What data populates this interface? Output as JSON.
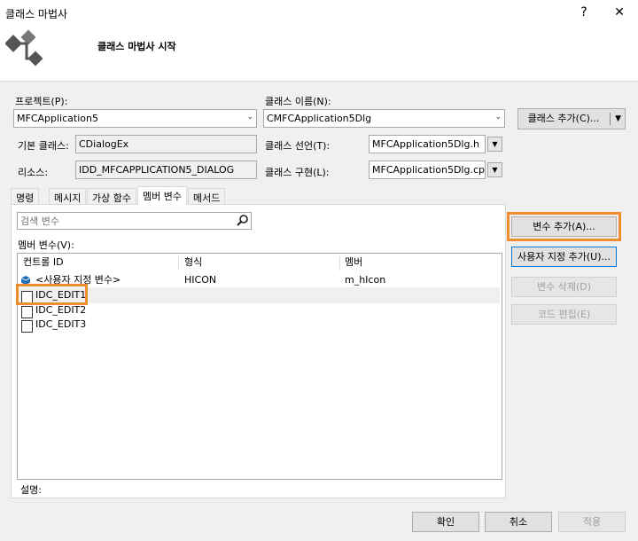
{
  "window": {
    "title": "클래스 마법사",
    "help_glyph": "?",
    "close_glyph": "✕",
    "header_title": "클래스 마법사 시작"
  },
  "project": {
    "label": "프로젝트(P):",
    "value": "MFCApplication5"
  },
  "class_name": {
    "label": "클래스 이름(N):",
    "value": "CMFCApplication5Dlg"
  },
  "add_class_button": "클래스 추가(C)...",
  "base_class": {
    "label": "기본 클래스:",
    "value": "CDialogEx"
  },
  "resource": {
    "label": "리소스:",
    "value": "IDD_MFCAPPLICATION5_DIALOG"
  },
  "class_declaration": {
    "label": "클래스 선언(T):",
    "value": "MFCApplication5Dlg.h"
  },
  "class_implementation": {
    "label": "클래스 구현(L):",
    "value": "MFCApplication5Dlg.cpp"
  },
  "tabs": [
    "명령",
    "메시지",
    "가상 함수",
    "멤버 변수",
    "메서드"
  ],
  "search": {
    "placeholder": "검색 변수"
  },
  "members_label": "멤버 변수(V):",
  "columns": [
    "컨트롤 ID",
    "형식",
    "멤버"
  ],
  "rows": [
    {
      "id": "<사용자 지정 변수>",
      "type": "HICON",
      "member": "m_hIcon"
    },
    {
      "id": "IDC_EDIT1",
      "type": "",
      "member": ""
    },
    {
      "id": "IDC_EDIT2",
      "type": "",
      "member": ""
    },
    {
      "id": "IDC_EDIT3",
      "type": "",
      "member": ""
    }
  ],
  "side_buttons": {
    "add_variable": "변수 추가(A)...",
    "add_custom": "사용자 지정 추가(U)...",
    "delete_variable": "변수 삭제(D)",
    "edit_code": "코드 편집(E)"
  },
  "description_label": "설명:",
  "footer": {
    "ok": "확인",
    "cancel": "취소",
    "apply": "적용"
  },
  "colors": {
    "highlight": "#f08c2e",
    "focus": "#0078d7"
  }
}
